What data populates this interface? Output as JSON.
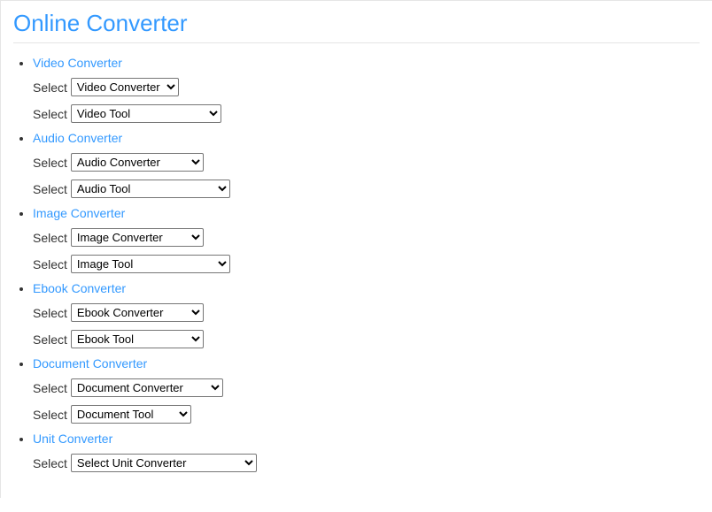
{
  "page": {
    "title": "Online Converter",
    "select_label": "Select"
  },
  "categories": [
    {
      "name": "Video Converter",
      "selects": [
        {
          "value": "Video Converter",
          "wclass": "w1"
        },
        {
          "value": "Video Tool",
          "wclass": "w2"
        }
      ]
    },
    {
      "name": "Audio Converter",
      "selects": [
        {
          "value": "Audio Converter",
          "wclass": "w3"
        },
        {
          "value": "Audio Tool",
          "wclass": "w4"
        }
      ]
    },
    {
      "name": "Image Converter",
      "selects": [
        {
          "value": "Image Converter",
          "wclass": "w5"
        },
        {
          "value": "Image Tool",
          "wclass": "w6"
        }
      ]
    },
    {
      "name": "Ebook Converter",
      "selects": [
        {
          "value": "Ebook Converter",
          "wclass": "w7"
        },
        {
          "value": "Ebook Tool",
          "wclass": "w8"
        }
      ]
    },
    {
      "name": "Document Converter",
      "selects": [
        {
          "value": "Document Converter",
          "wclass": "w9"
        },
        {
          "value": "Document Tool",
          "wclass": "w10"
        }
      ]
    },
    {
      "name": "Unit Converter",
      "selects": [
        {
          "value": "Select Unit Converter",
          "wclass": "w11"
        }
      ]
    }
  ]
}
